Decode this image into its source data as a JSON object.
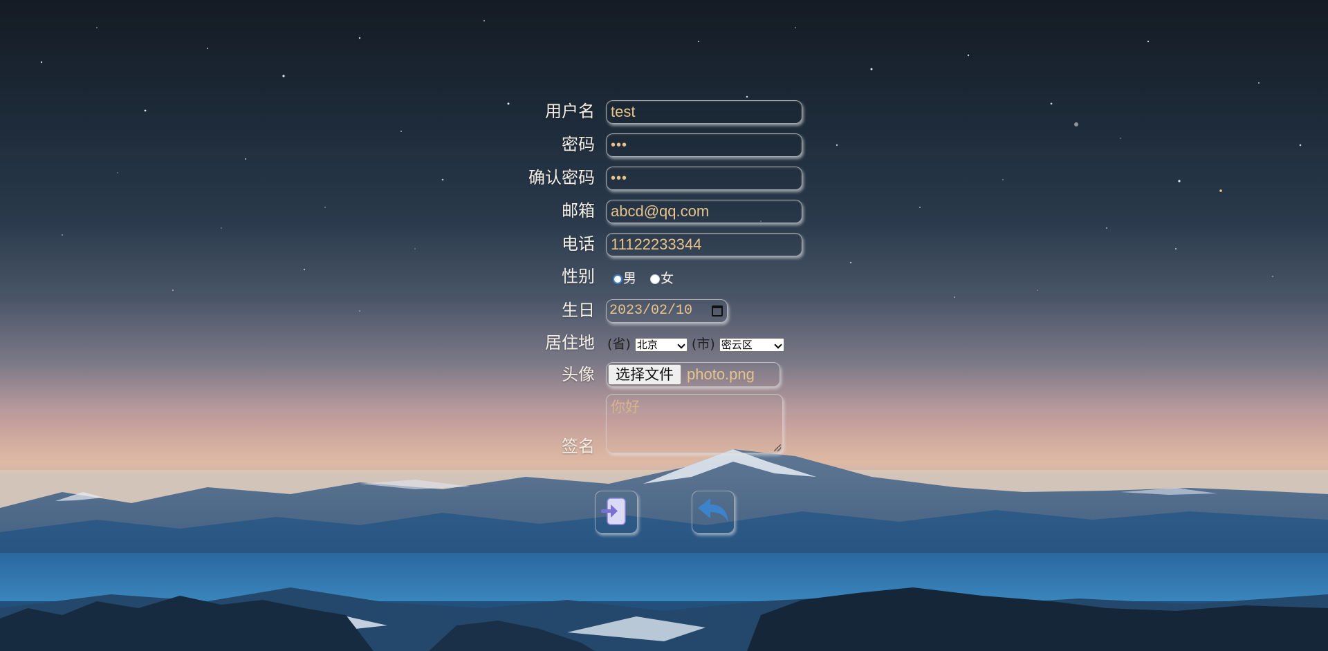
{
  "form": {
    "username": {
      "label": "用户名",
      "value": "test"
    },
    "password": {
      "label": "密码",
      "value": "•••"
    },
    "confirm_password": {
      "label": "确认密码",
      "value": "•••"
    },
    "email": {
      "label": "邮箱",
      "value": "abcd@qq.com"
    },
    "phone": {
      "label": "电话",
      "value": "11122233344"
    },
    "gender": {
      "label": "性别",
      "options": [
        "男",
        "女"
      ],
      "selected": "男"
    },
    "birthday": {
      "label": "生日",
      "value": "2023/02/10"
    },
    "residence": {
      "label": "居住地",
      "province_prefix": "(省)",
      "province_value": "北京",
      "city_prefix": "(市)",
      "city_value": "密云区"
    },
    "avatar": {
      "label": "头像",
      "button_label": "选择文件",
      "file_name": "photo.png"
    },
    "signature": {
      "label": "签名",
      "value": "你好"
    }
  },
  "actions": {
    "submit_icon": "login-arrow-icon",
    "back_icon": "reply-arrow-icon"
  },
  "colors": {
    "input_text": "#e7c48b",
    "label_text": "#f4efe6",
    "submit_icon_fill": "#dad9f6",
    "submit_icon_arrow": "#7b6fd6",
    "back_icon": "#3d83cc"
  }
}
